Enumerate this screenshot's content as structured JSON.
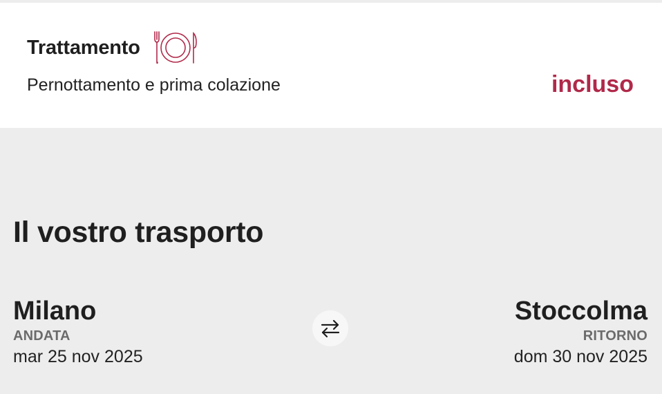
{
  "board": {
    "title": "Trattamento",
    "icon": "plate-cutlery-icon",
    "description": "Pernottamento e prima colazione",
    "status": "incluso",
    "accent_color": "#b0294a"
  },
  "transport": {
    "title": "Il vostro trasporto",
    "swap_icon": "swap-arrows-icon",
    "outbound": {
      "city": "Milano",
      "kind": "ANDATA",
      "date": "mar 25 nov 2025"
    },
    "return": {
      "city": "Stoccolma",
      "kind": "RITORNO",
      "date": "dom 30 nov 2025"
    }
  }
}
